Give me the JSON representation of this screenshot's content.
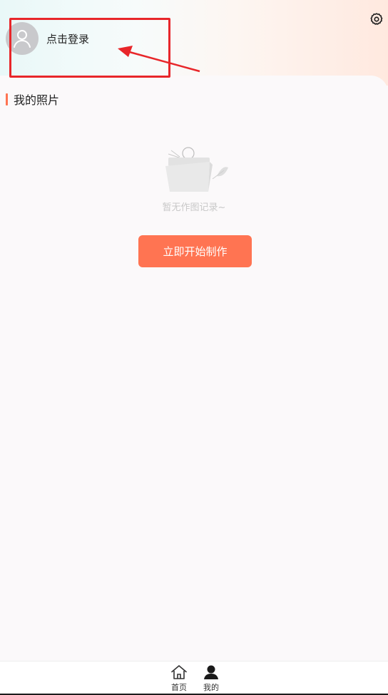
{
  "header": {
    "login_label": "点击登录"
  },
  "section": {
    "title": "我的照片"
  },
  "empty": {
    "text": "暂无作图记录~"
  },
  "action": {
    "start_label": "立即开始制作"
  },
  "tabbar": {
    "items": [
      {
        "label": "首页",
        "icon": "home-icon"
      },
      {
        "label": "我的",
        "icon": "user-icon"
      }
    ]
  },
  "colors": {
    "accent": "#ff7452",
    "annotation": "#e8262a",
    "avatar": "#c9c9cc"
  }
}
